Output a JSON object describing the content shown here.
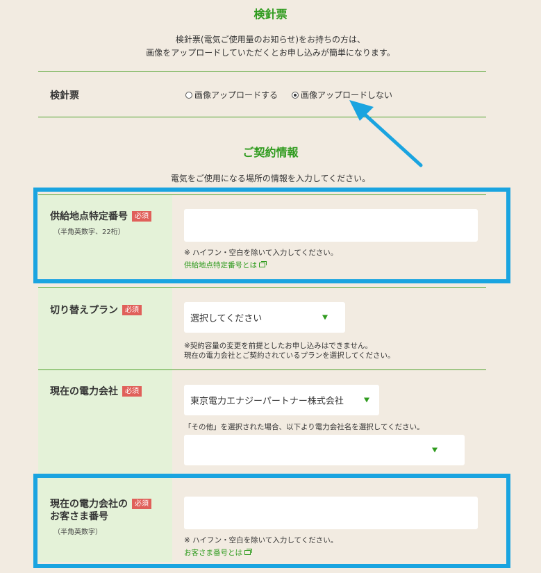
{
  "meter_section": {
    "title": "検針票",
    "intro_line1": "検針票(電気ご使用量のお知らせ)をお持ちの方は、",
    "intro_line2": "画像をアップロードしていただくとお申し込みが簡単になります。",
    "label": "検針票",
    "option_upload": "画像アップロードする",
    "option_no_upload": "画像アップロードしない",
    "selected": "画像アップロードしない"
  },
  "contract_section": {
    "title": "ご契約情報",
    "intro": "電気をご使用になる場所の情報を入力してください。"
  },
  "required_badge": "必須",
  "supply_point": {
    "label": "供給地点特定番号",
    "sub": "（半角英数字、22桁）",
    "value": "",
    "note": "※ ハイフン・空白を除いて入力してください。",
    "link": "供給地点特定番号とは"
  },
  "switch_plan": {
    "label": "切り替えプラン",
    "selected": "選択してください",
    "note_line1": "※契約容量の変更を前提としたお申し込みはできません。",
    "note_line2": "現在の電力会社とご契約されているプランを選択してください。"
  },
  "current_company": {
    "label": "現在の電力会社",
    "selected": "東京電力エナジーパートナー株式会社",
    "note": "「その他」を選択された場合、以下より電力会社名を選択してください。",
    "other_selected": ""
  },
  "customer_number": {
    "label_line1": "現在の電力会社の",
    "label_line2": "お客さま番号",
    "sub": "（半角英数字）",
    "value": "",
    "note": "※ ハイフン・空白を除いて入力してください。",
    "link": "お客さま番号とは"
  },
  "colors": {
    "accent_green": "#2f9b1e",
    "highlight_blue": "#1aa4e0",
    "required_red": "#e0605a",
    "label_bg": "#e4f2d8"
  }
}
